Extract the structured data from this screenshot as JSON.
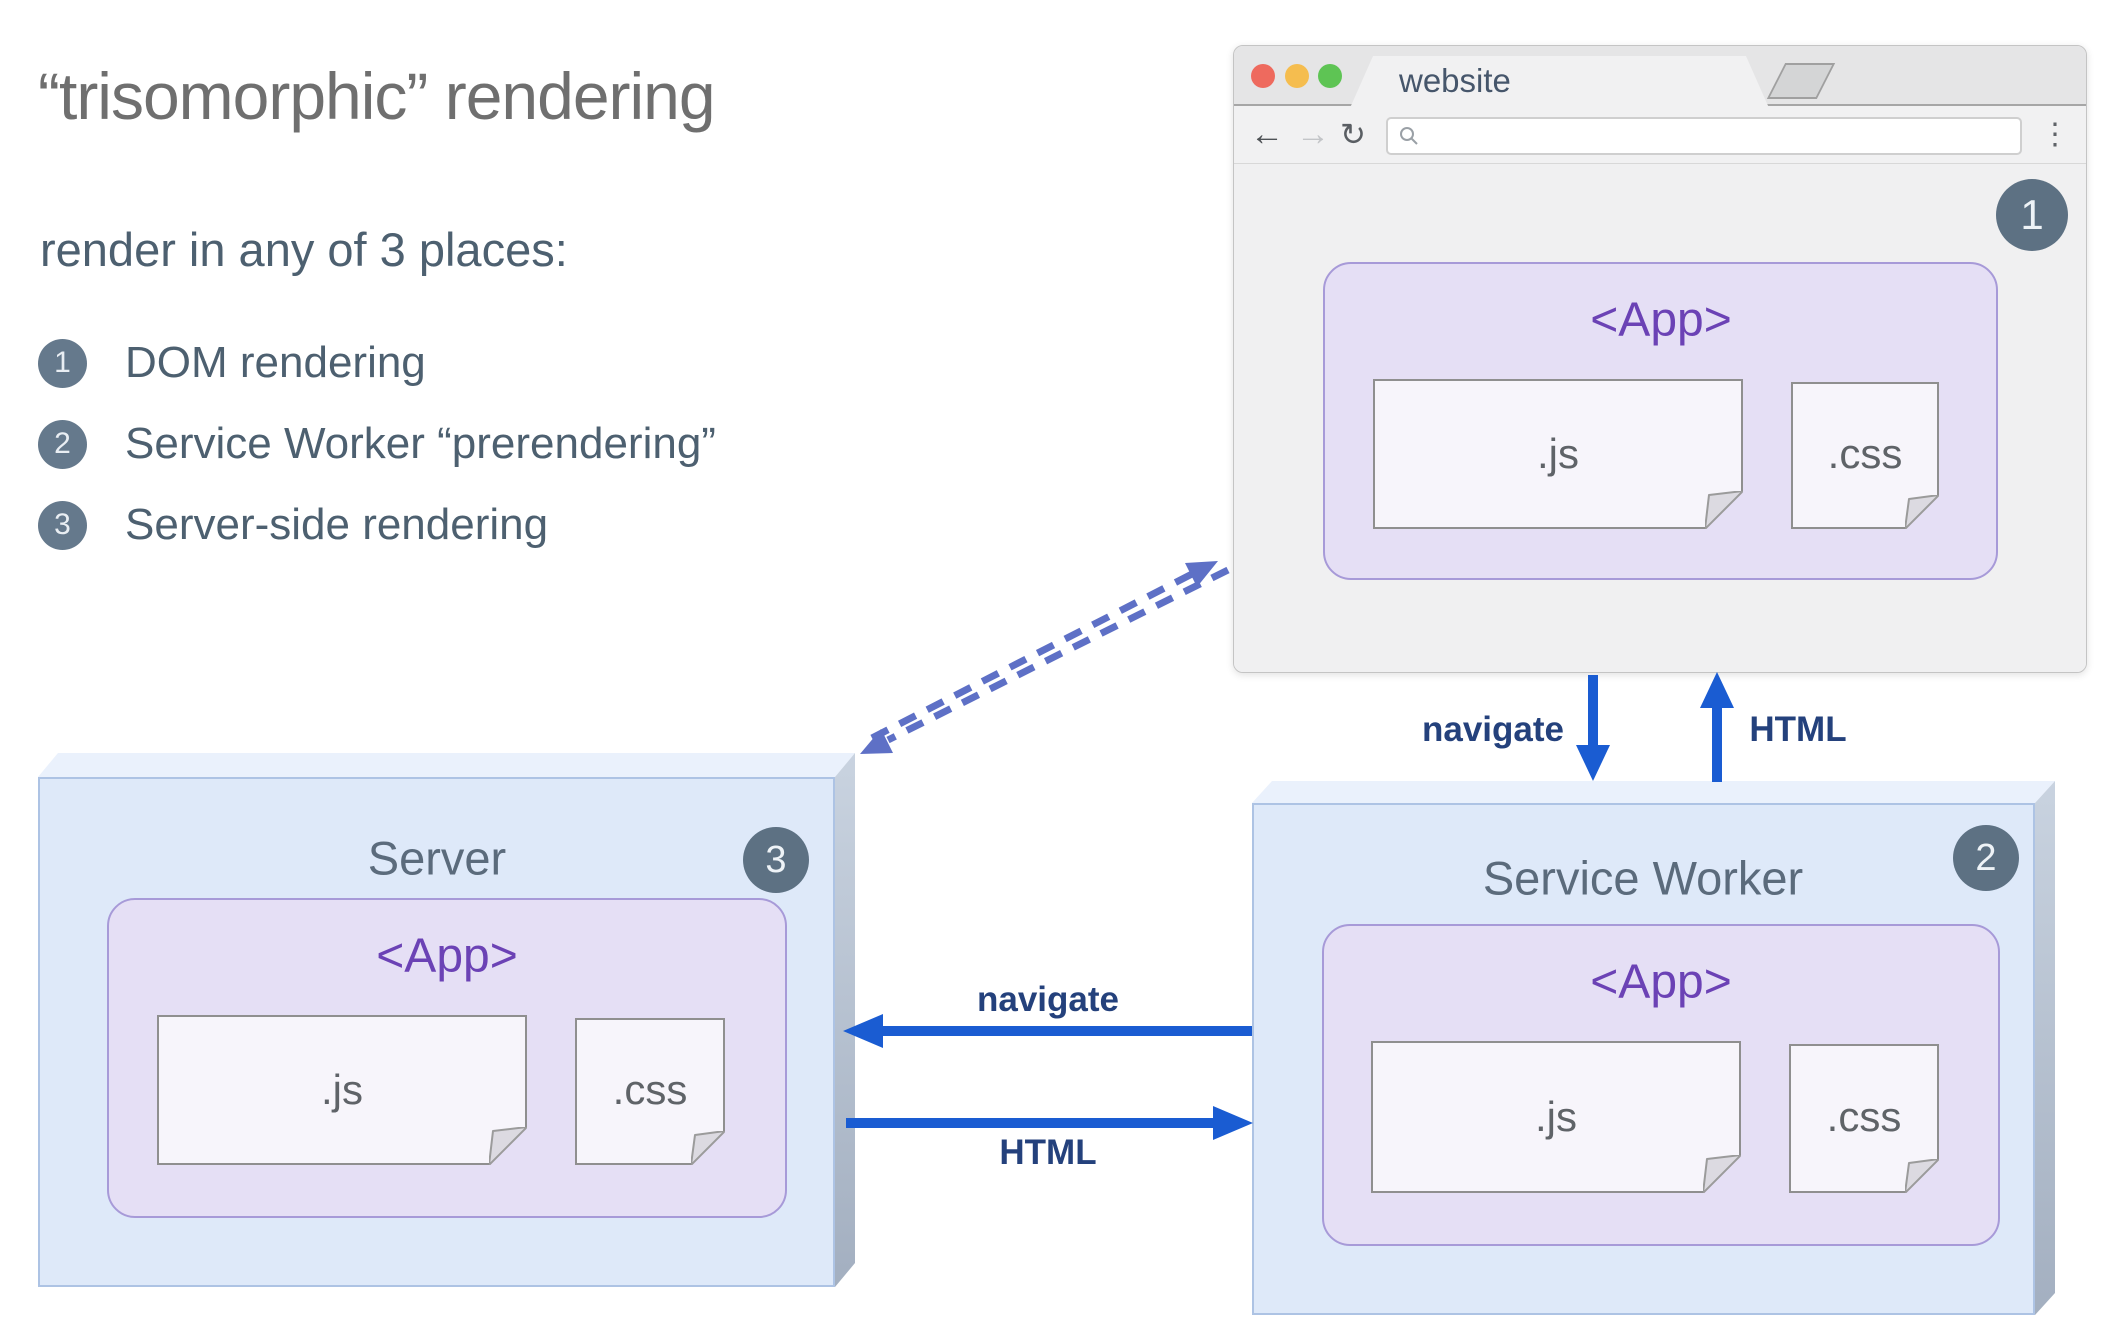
{
  "page": {
    "title_text": "“trisomorphic” rendering",
    "subtitle": "render in any of 3 places:"
  },
  "list": [
    {
      "num": "1",
      "label": "DOM rendering"
    },
    {
      "num": "2",
      "label": "Service Worker “prerendering”"
    },
    {
      "num": "3",
      "label": "Server-side rendering"
    }
  ],
  "browser": {
    "tab_title": "website",
    "badge": "1",
    "url_value": "",
    "toolbar": {
      "back": "←",
      "forward": "→",
      "refresh": "↻",
      "menu": "⋮"
    },
    "app": {
      "label": "<App>",
      "js": ".js",
      "css": ".css"
    }
  },
  "server": {
    "title": "Server",
    "badge": "3",
    "app": {
      "label": "<App>",
      "js": ".js",
      "css": ".css"
    }
  },
  "service_worker": {
    "title": "Service Worker",
    "badge": "2",
    "app": {
      "label": "<App>",
      "js": ".js",
      "css": ".css"
    }
  },
  "arrows": {
    "navigate_down": "navigate",
    "html_up": "HTML",
    "navigate_left": "navigate",
    "html_right": "HTML"
  },
  "colors": {
    "arrow_blue": "#1a5cd2",
    "arrow_label_navy": "#24417c",
    "dashed_periwinkle": "#5e70c6",
    "badge_slate": "#5d7183",
    "box_blue": "#dee9f9",
    "app_lavender": "#e5dff5",
    "app_purple": "#6b42b5",
    "title_gray": "#6f6f6f",
    "text_slate": "#4d6070"
  }
}
